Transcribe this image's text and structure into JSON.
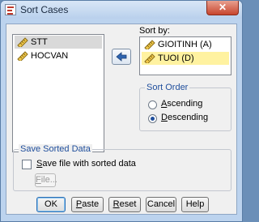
{
  "window": {
    "title": "Sort Cases",
    "close_label": "✕"
  },
  "variables": {
    "items": [
      {
        "label": "STT"
      },
      {
        "label": "HOCVAN"
      }
    ]
  },
  "sort_by": {
    "label": "Sort by:",
    "items": [
      {
        "label": "GIOITINH (A)"
      },
      {
        "label": "TUOI (D)"
      }
    ]
  },
  "sort_order": {
    "title": "Sort Order",
    "ascending_first": "A",
    "ascending_rest": "scending",
    "descending_first": "D",
    "descending_rest": "escending",
    "selected": "Descending"
  },
  "save": {
    "title": "Save Sorted Data",
    "checkbox_first": "S",
    "checkbox_rest": "ave file with sorted data",
    "file_first": "F",
    "file_rest": "ile..."
  },
  "buttons": {
    "ok": "OK",
    "paste_first": "P",
    "paste_rest": "aste",
    "reset_first": "R",
    "reset_rest": "eset",
    "cancel": "Cancel",
    "help": "Help"
  }
}
